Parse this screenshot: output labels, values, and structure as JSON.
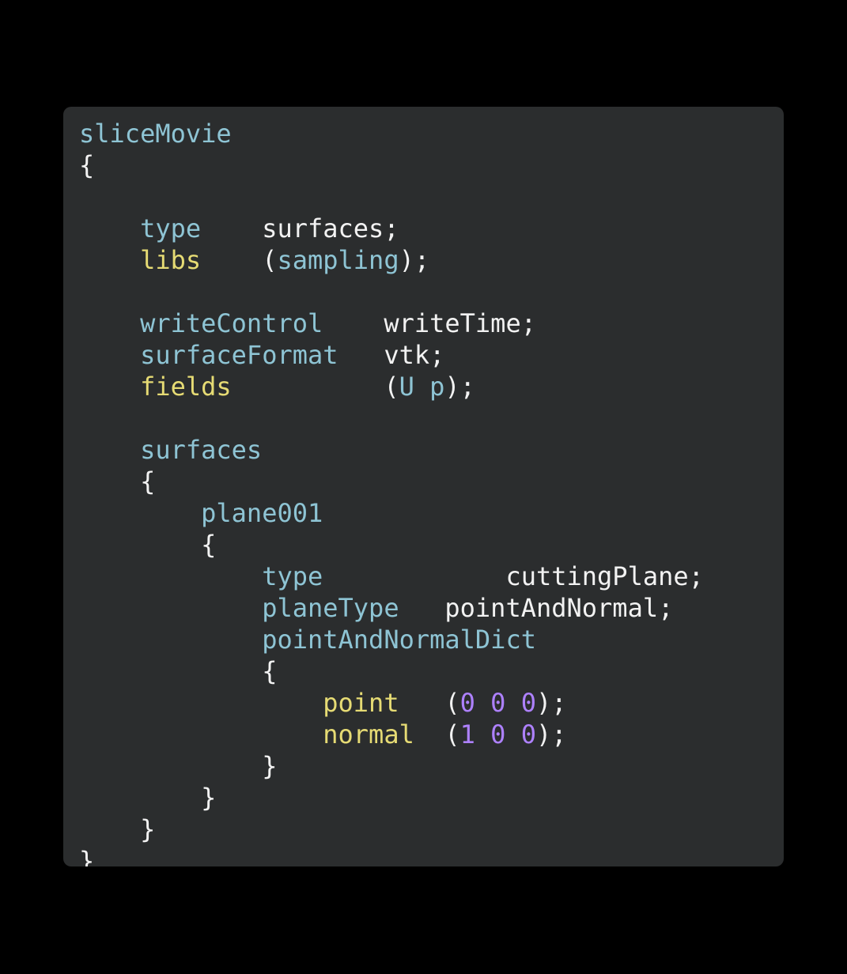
{
  "window": {
    "background_color": "#000000",
    "card_background_color": "#2b2d2e"
  },
  "theme": {
    "key_color": "#8ec4d4",
    "keyword_color": "#e6db74",
    "value_color": "#f2f2f2",
    "number_color": "#ae81ff",
    "punctuation_color": "#f2f2f2"
  },
  "code": {
    "language": "OpenFOAM dictionary",
    "lines": [
      {
        "indent": 0,
        "tokens": [
          {
            "t": "sliceMovie",
            "c": "key"
          }
        ]
      },
      {
        "indent": 0,
        "tokens": [
          {
            "t": "{",
            "c": "punct"
          }
        ]
      },
      {
        "indent": 0,
        "tokens": []
      },
      {
        "indent": 4,
        "tokens": [
          {
            "t": "type",
            "c": "key"
          },
          {
            "t": "    ",
            "c": "plain"
          },
          {
            "t": "surfaces;",
            "c": "value"
          }
        ]
      },
      {
        "indent": 4,
        "tokens": [
          {
            "t": "libs",
            "c": "keyword"
          },
          {
            "t": "    ",
            "c": "plain"
          },
          {
            "t": "(",
            "c": "punct"
          },
          {
            "t": "sampling",
            "c": "key"
          },
          {
            "t": ");",
            "c": "punct"
          }
        ]
      },
      {
        "indent": 0,
        "tokens": []
      },
      {
        "indent": 4,
        "tokens": [
          {
            "t": "writeControl",
            "c": "key"
          },
          {
            "t": "    ",
            "c": "plain"
          },
          {
            "t": "writeTime;",
            "c": "value"
          }
        ]
      },
      {
        "indent": 4,
        "tokens": [
          {
            "t": "surfaceFormat",
            "c": "key"
          },
          {
            "t": "   ",
            "c": "plain"
          },
          {
            "t": "vtk;",
            "c": "value"
          }
        ]
      },
      {
        "indent": 4,
        "tokens": [
          {
            "t": "fields",
            "c": "keyword"
          },
          {
            "t": "          ",
            "c": "plain"
          },
          {
            "t": "(",
            "c": "punct"
          },
          {
            "t": "U",
            "c": "key"
          },
          {
            "t": " ",
            "c": "plain"
          },
          {
            "t": "p",
            "c": "key"
          },
          {
            "t": ");",
            "c": "punct"
          }
        ]
      },
      {
        "indent": 0,
        "tokens": []
      },
      {
        "indent": 4,
        "tokens": [
          {
            "t": "surfaces",
            "c": "key"
          }
        ]
      },
      {
        "indent": 4,
        "tokens": [
          {
            "t": "{",
            "c": "punct"
          }
        ]
      },
      {
        "indent": 8,
        "tokens": [
          {
            "t": "plane001",
            "c": "key"
          }
        ]
      },
      {
        "indent": 8,
        "tokens": [
          {
            "t": "{",
            "c": "punct"
          }
        ]
      },
      {
        "indent": 12,
        "tokens": [
          {
            "t": "type",
            "c": "key"
          },
          {
            "t": "            ",
            "c": "plain"
          },
          {
            "t": "cuttingPlane;",
            "c": "value"
          }
        ]
      },
      {
        "indent": 12,
        "tokens": [
          {
            "t": "planeType",
            "c": "key"
          },
          {
            "t": "   ",
            "c": "plain"
          },
          {
            "t": "pointAndNormal;",
            "c": "value"
          }
        ]
      },
      {
        "indent": 12,
        "tokens": [
          {
            "t": "pointAndNormalDict",
            "c": "key"
          }
        ]
      },
      {
        "indent": 12,
        "tokens": [
          {
            "t": "{",
            "c": "punct"
          }
        ]
      },
      {
        "indent": 16,
        "tokens": [
          {
            "t": "point",
            "c": "keyword"
          },
          {
            "t": "   ",
            "c": "plain"
          },
          {
            "t": "(",
            "c": "punct"
          },
          {
            "t": "0",
            "c": "num"
          },
          {
            "t": " ",
            "c": "plain"
          },
          {
            "t": "0",
            "c": "num"
          },
          {
            "t": " ",
            "c": "plain"
          },
          {
            "t": "0",
            "c": "num"
          },
          {
            "t": ");",
            "c": "punct"
          }
        ]
      },
      {
        "indent": 16,
        "tokens": [
          {
            "t": "normal",
            "c": "keyword"
          },
          {
            "t": "  ",
            "c": "plain"
          },
          {
            "t": "(",
            "c": "punct"
          },
          {
            "t": "1",
            "c": "num"
          },
          {
            "t": " ",
            "c": "plain"
          },
          {
            "t": "0",
            "c": "num"
          },
          {
            "t": " ",
            "c": "plain"
          },
          {
            "t": "0",
            "c": "num"
          },
          {
            "t": ");",
            "c": "punct"
          }
        ]
      },
      {
        "indent": 12,
        "tokens": [
          {
            "t": "}",
            "c": "punct"
          }
        ]
      },
      {
        "indent": 8,
        "tokens": [
          {
            "t": "}",
            "c": "punct"
          }
        ]
      },
      {
        "indent": 4,
        "tokens": [
          {
            "t": "}",
            "c": "punct"
          }
        ]
      },
      {
        "indent": 0,
        "tokens": [
          {
            "t": "}",
            "c": "punct"
          }
        ]
      }
    ]
  }
}
